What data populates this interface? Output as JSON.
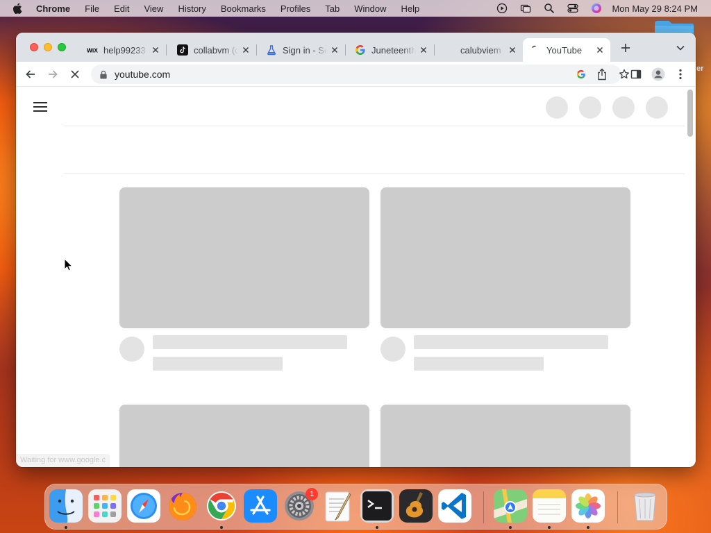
{
  "menubar": {
    "app_name": "Chrome",
    "menus": [
      "File",
      "Edit",
      "View",
      "History",
      "Bookmarks",
      "Profiles",
      "Tab",
      "Window",
      "Help"
    ],
    "clock": "Mon May 29  8:24 PM"
  },
  "desktop": {
    "label": "er"
  },
  "browser": {
    "tabs": [
      {
        "title": "help99233",
        "icon": "wix-icon"
      },
      {
        "title": "collabvm (c",
        "icon": "tiktok-icon"
      },
      {
        "title": "Sign in - Se",
        "icon": "flask-icon"
      },
      {
        "title": "Juneteenth",
        "icon": "google-icon"
      },
      {
        "title": "calubviem",
        "icon": "blank-icon"
      },
      {
        "title": "YouTube",
        "icon": "loading-icon",
        "active": true
      }
    ],
    "url": "youtube.com",
    "status_text": "Waiting for www.google.c"
  },
  "dock": {
    "apps": [
      "Finder",
      "Launchpad",
      "Safari",
      "Firefox",
      "Google Chrome",
      "App Store",
      "System Preferences",
      "TextEdit",
      "Terminal",
      "GarageBand",
      "Visual Studio Code",
      "Maps",
      "Notes",
      "Photos",
      "Trash"
    ],
    "system_preferences_badge": "1"
  },
  "colors": {
    "tabstrip": "#dee1e6",
    "skeleton_thumb": "#cccccc",
    "skeleton_meta": "#e3e3e3"
  }
}
